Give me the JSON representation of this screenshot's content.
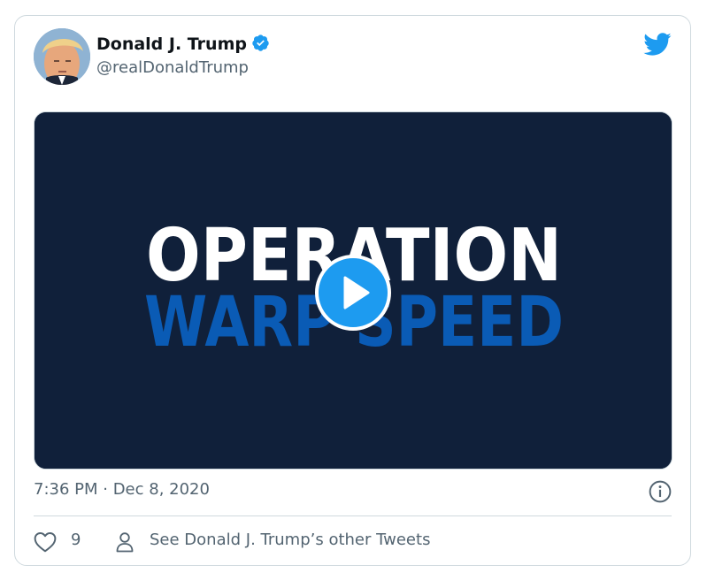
{
  "tweet": {
    "author": {
      "display_name": "Donald J. Trump",
      "handle": "@realDonaldTrump",
      "verified": true
    },
    "media": {
      "type": "video",
      "title_line1": "OPERATION",
      "title_line2": "WARP SPEED",
      "background_color": "#10203a",
      "line2_color": "#0a5bb5"
    },
    "timestamp": "7:36 PM · Dec 8, 2020",
    "likes_count": "9",
    "profile_link_label": "See Donald J. Trump’s other Tweets"
  },
  "icons": {
    "logo": "twitter-bird-icon",
    "verified": "verified-badge-icon",
    "play": "play-icon",
    "info": "info-icon",
    "like": "heart-icon",
    "profile": "person-icon"
  },
  "colors": {
    "twitter_blue": "#1d9bf0",
    "text_primary": "#0f1419",
    "text_secondary": "#536471",
    "border": "#cfd9de"
  }
}
